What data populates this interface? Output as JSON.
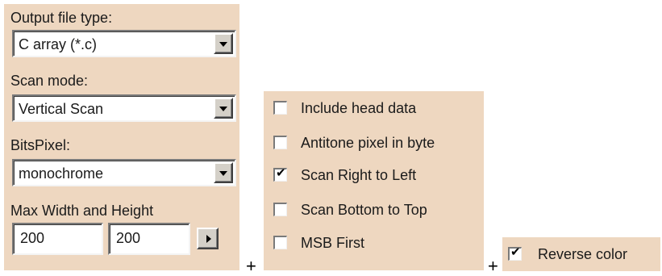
{
  "left_panel": {
    "output_file_type": {
      "label": "Output file type:",
      "value": "C array (*.c)"
    },
    "scan_mode": {
      "label": "Scan mode:",
      "value": "Vertical Scan"
    },
    "bits_pixel": {
      "label": "BitsPixel:",
      "value": "monochrome"
    },
    "max_size": {
      "label": "Max Width and Height",
      "width": "200",
      "height": "200"
    }
  },
  "middle_panel": {
    "options": [
      {
        "label": "Include head data",
        "checked": false
      },
      {
        "label": "Antitone pixel in byte",
        "checked": false
      },
      {
        "label": "Scan Right to Left",
        "checked": true
      },
      {
        "label": "Scan Bottom to Top",
        "checked": false
      },
      {
        "label": "MSB First",
        "checked": false
      }
    ]
  },
  "right_panel": {
    "reverse_color": {
      "label": "Reverse color",
      "checked": true
    }
  },
  "separators": {
    "plus_1": "+",
    "plus_2": "+"
  },
  "icons": {
    "check_mark": "✔",
    "dropdown": "chevron-down-icon",
    "apply": "arrow-right-icon"
  },
  "colors": {
    "panel_bg": "#eed7c0",
    "button_face": "#d4d0c8"
  }
}
